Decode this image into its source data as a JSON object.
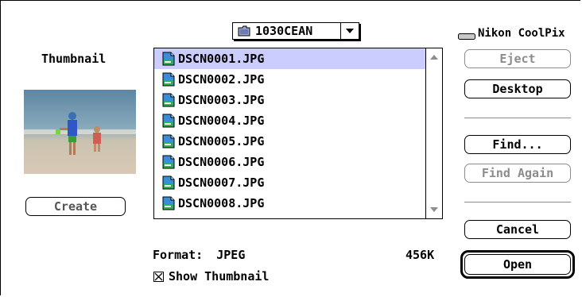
{
  "folder_popup": {
    "label": "1030CEAN",
    "icon": "folder-icon"
  },
  "volume": {
    "label": "Nikon CoolPix",
    "icon": "drive-icon"
  },
  "thumbnail": {
    "heading": "Thumbnail",
    "create_label": "Create"
  },
  "files": [
    {
      "name": "DSCN0001.JPG",
      "icon": "jpeg-file-icon",
      "selected": true
    },
    {
      "name": "DSCN0002.JPG",
      "icon": "jpeg-file-icon",
      "selected": false
    },
    {
      "name": "DSCN0003.JPG",
      "icon": "jpeg-file-icon",
      "selected": false
    },
    {
      "name": "DSCN0004.JPG",
      "icon": "jpeg-file-icon",
      "selected": false
    },
    {
      "name": "DSCN0005.JPG",
      "icon": "jpeg-file-icon",
      "selected": false
    },
    {
      "name": "DSCN0006.JPG",
      "icon": "jpeg-file-icon",
      "selected": false
    },
    {
      "name": "DSCN0007.JPG",
      "icon": "jpeg-file-icon",
      "selected": false
    },
    {
      "name": "DSCN0008.JPG",
      "icon": "jpeg-file-icon",
      "selected": false
    }
  ],
  "buttons": {
    "eject": "Eject",
    "desktop": "Desktop",
    "find": "Find...",
    "find_again": "Find Again",
    "cancel": "Cancel",
    "open": "Open"
  },
  "info": {
    "format_label": "Format:",
    "format_value": "JPEG",
    "size": "456K"
  },
  "show_thumbnail": {
    "label": "Show Thumbnail",
    "checked": true
  },
  "colors": {
    "selection": "#cbccff",
    "disabled": "#8c8c8c"
  }
}
